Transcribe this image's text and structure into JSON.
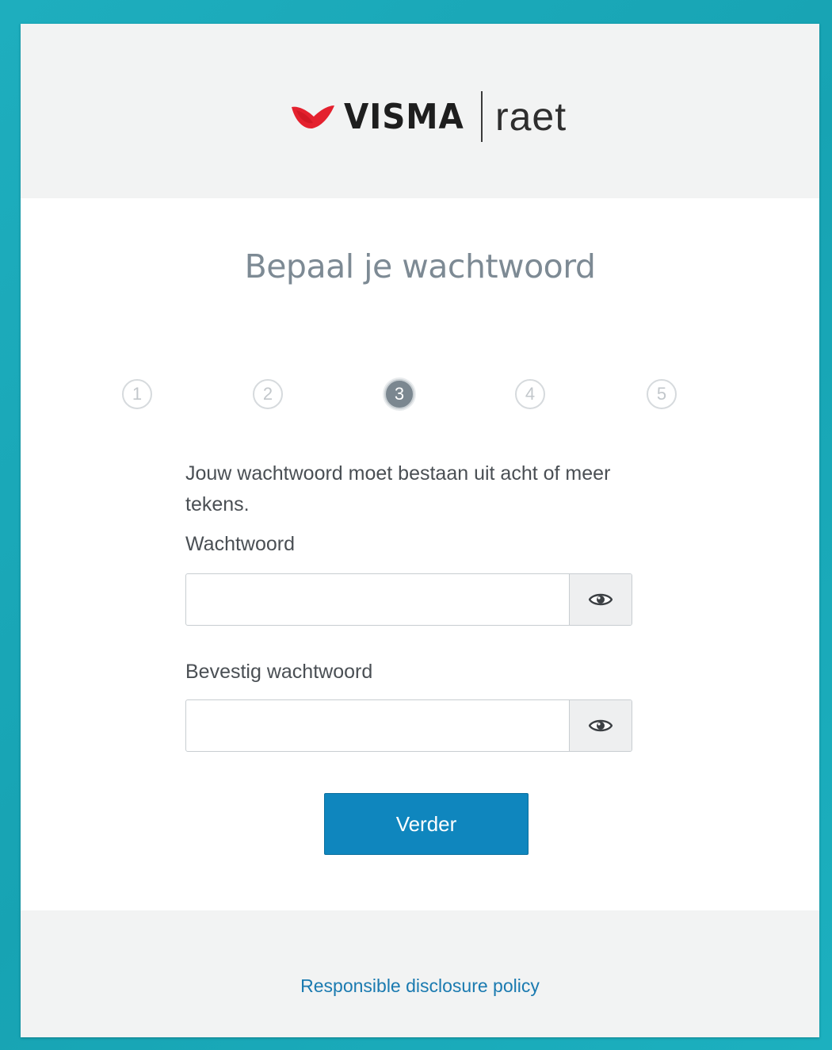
{
  "brand": {
    "name_primary": "VISMA",
    "name_secondary": "raet",
    "accent_color": "#e4212e",
    "logo_icon": "visma-swoosh-icon"
  },
  "page": {
    "title": "Bepaal je wachtwoord",
    "background_color": "#1aa8b8"
  },
  "steps": {
    "items": [
      "1",
      "2",
      "3",
      "4",
      "5"
    ],
    "active_index": 2
  },
  "form": {
    "intro": "Jouw wachtwoord moet bestaan uit acht of meer tekens.",
    "password": {
      "label": "Wachtwoord",
      "value": "",
      "toggle_icon": "eye-icon"
    },
    "confirm": {
      "label": "Bevestig wachtwoord",
      "value": "",
      "toggle_icon": "eye-icon"
    },
    "submit_label": "Verder",
    "submit_color": "#0f86be"
  },
  "footer": {
    "link_label": "Responsible disclosure policy",
    "link_color": "#1a7ab0"
  }
}
